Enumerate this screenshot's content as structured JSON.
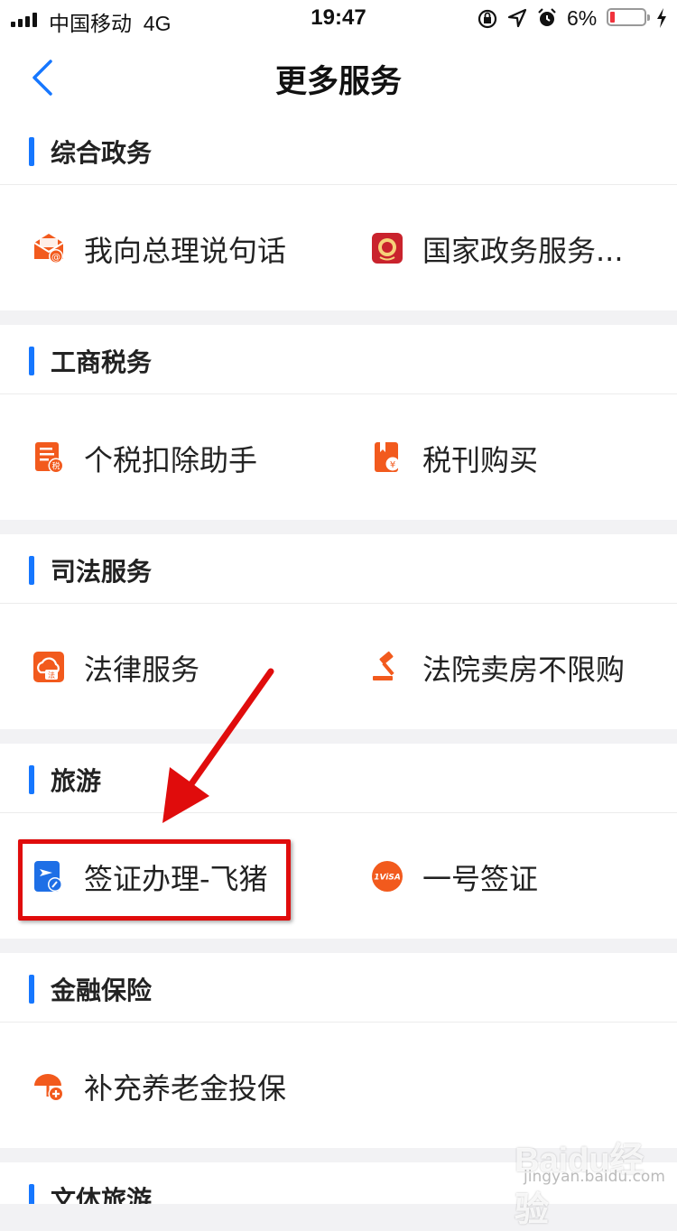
{
  "status_bar": {
    "carrier": "中国移动",
    "network": "4G",
    "time": "19:47",
    "battery_percent": "6%",
    "battery_level": 0.06
  },
  "nav": {
    "title": "更多服务"
  },
  "sections": [
    {
      "title": "综合政务",
      "items": [
        {
          "label": "我向总理说句话",
          "icon": "envelope-at-icon"
        },
        {
          "label": "国家政务服务...",
          "icon": "national-emblem-icon"
        }
      ]
    },
    {
      "title": "工商税务",
      "items": [
        {
          "label": "个税扣除助手",
          "icon": "tax-document-icon"
        },
        {
          "label": "税刊购买",
          "icon": "book-yuan-icon"
        }
      ]
    },
    {
      "title": "司法服务",
      "items": [
        {
          "label": "法律服务",
          "icon": "cloud-law-icon"
        },
        {
          "label": "法院卖房不限购",
          "icon": "gavel-icon"
        }
      ]
    },
    {
      "title": "旅游",
      "items": [
        {
          "label": "签证办理-飞猪",
          "icon": "plane-pen-icon"
        },
        {
          "label": "一号签证",
          "icon": "visa-badge-icon"
        }
      ]
    },
    {
      "title": "金融保险",
      "items": [
        {
          "label": "补充养老金投保",
          "icon": "umbrella-plus-icon"
        }
      ]
    },
    {
      "title": "文体旅游",
      "items": []
    }
  ],
  "colors": {
    "accent": "#1677ff",
    "icon_orange": "#f25a1d",
    "highlight_red": "#e00c0c"
  },
  "watermark": {
    "main": "Baidu经验",
    "sub": "jingyan.baidu.com"
  }
}
